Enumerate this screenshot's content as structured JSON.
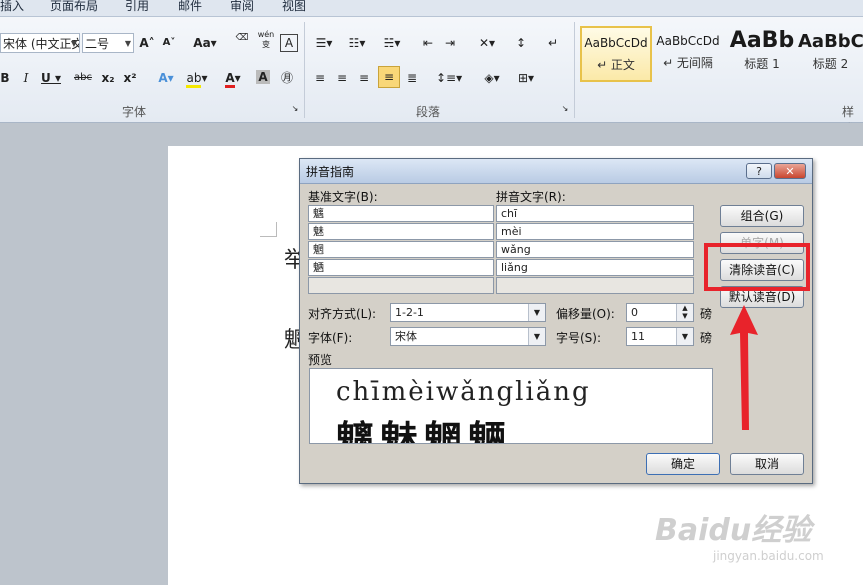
{
  "ribbon": {
    "tabs": [
      "插入",
      "页面布局",
      "引用",
      "邮件",
      "审阅",
      "视图"
    ],
    "font_name": "宋体 (中文正文",
    "font_size": "二号",
    "groups": [
      "字体",
      "段落",
      "样式"
    ],
    "styles": [
      {
        "sample": "AaBbCcDd",
        "name": "↵ 正文"
      },
      {
        "sample": "AaBbCcDd",
        "name": "↵ 无间隔"
      },
      {
        "sample": "AaBb",
        "name": "标题 1"
      },
      {
        "sample": "AaBbC",
        "name": "标题 2"
      }
    ],
    "btn_aa": "Aa",
    "btn_abc": "abc",
    "btn_wen": "wén",
    "btn_A": "A"
  },
  "document": {
    "fragment_line1": "举",
    "fragment_line2": "魍"
  },
  "dialog": {
    "title": "拼音指南",
    "help_btn": "?",
    "close_btn": "✕",
    "base_text_label": "基准文字(B):",
    "pinyin_text_label": "拼音文字(R):",
    "rows": [
      {
        "base": "魑",
        "pinyin": "chī"
      },
      {
        "base": "魅",
        "pinyin": "mèi"
      },
      {
        "base": "魍",
        "pinyin": "wǎng"
      },
      {
        "base": "魉",
        "pinyin": "liǎng"
      }
    ],
    "btn_group": "组合(G)",
    "btn_single": "单字(M)",
    "btn_clear": "清除读音(C)",
    "btn_default": "默认读音(D)",
    "align_label": "对齐方式(L):",
    "align_value": "1-2-1",
    "offset_label": "偏移量(O):",
    "offset_value": "0",
    "offset_unit": "磅",
    "font_label": "字体(F):",
    "font_value": "宋体",
    "size_label": "字号(S):",
    "size_value": "11",
    "size_unit": "磅",
    "preview_label": "预览",
    "preview_pinyin": "chīmèiwǎngliǎng",
    "preview_chars": "魑魅魍魉",
    "ok_btn": "确定",
    "cancel_btn": "取消"
  },
  "watermark": {
    "brand": "Baidu经验",
    "url": "jingyan.baidu.com"
  },
  "colors": {
    "highlight": "#e8232b",
    "selected_style_border": "#e8c24a"
  }
}
